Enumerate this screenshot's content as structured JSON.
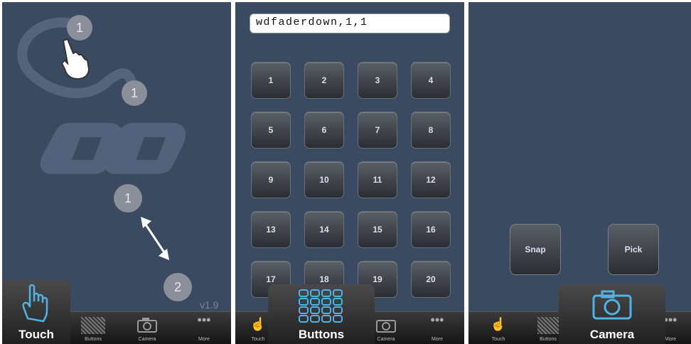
{
  "touch_panel": {
    "markers": [
      "1",
      "1",
      "1",
      "2"
    ],
    "version": "v1.9"
  },
  "buttons_panel": {
    "command_field_value": "wdfaderdown,1,1",
    "buttons": [
      "1",
      "2",
      "3",
      "4",
      "5",
      "6",
      "7",
      "8",
      "9",
      "10",
      "11",
      "12",
      "13",
      "14",
      "15",
      "16",
      "17",
      "18",
      "19",
      "20"
    ]
  },
  "camera_panel": {
    "snap_label": "Snap",
    "pick_label": "Pick"
  },
  "tabs": {
    "touch": "Touch",
    "buttons": "Buttons",
    "camera": "Camera",
    "more": "More"
  },
  "colors": {
    "background": "#3a4a60",
    "accent_icon": "#4fb3e8"
  }
}
